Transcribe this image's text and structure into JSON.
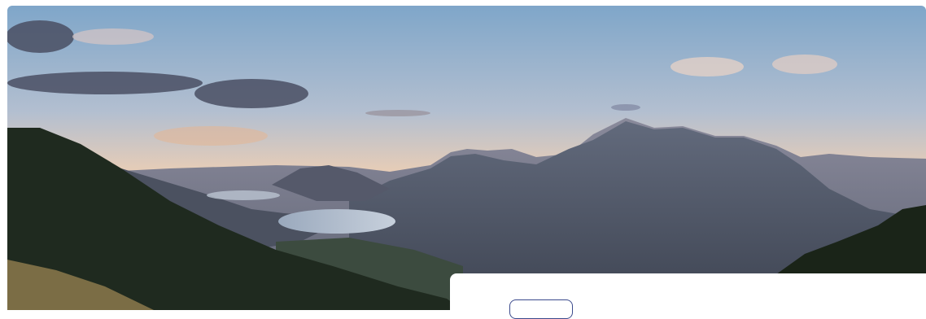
{
  "hero": {
    "image_subject": "mountain-lake-sunset",
    "colors": {
      "sky_top": "#7fa6c9",
      "sky_mid": "#c9c6cf",
      "horizon": "#f3c79e",
      "mountain_far": "#6b6f84",
      "mountain_near": "#474c5c",
      "lake": "#b9c3d2",
      "forest": "#1f2a1f",
      "grass": "#7b6d45"
    }
  },
  "card": {
    "button_label": ""
  }
}
